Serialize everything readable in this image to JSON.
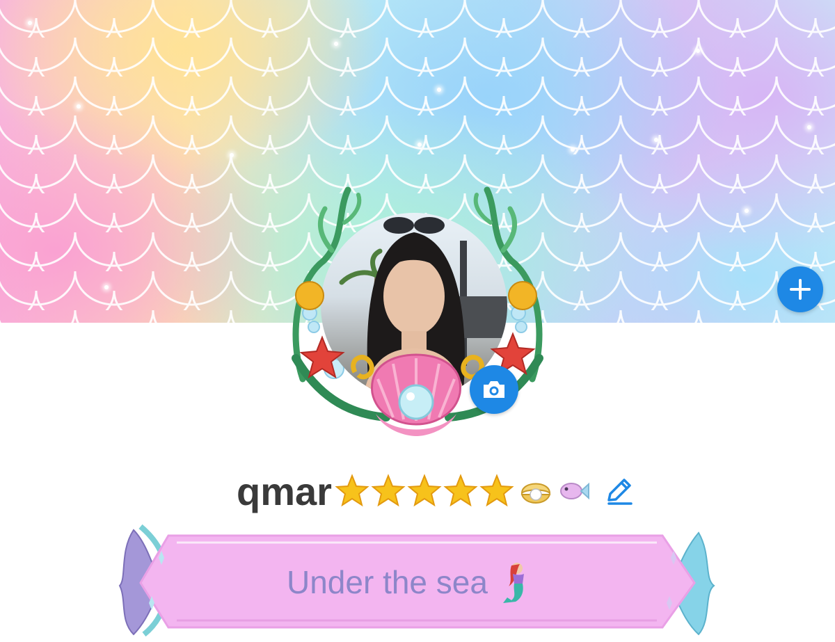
{
  "profile": {
    "username": "qmar",
    "rating_stars": 5,
    "status": "Under the sea"
  },
  "icons": {
    "add_cover": "plus-icon",
    "change_photo": "camera-icon",
    "edit_name": "pencil-icon",
    "name_badges": [
      "star-icon",
      "star-icon",
      "star-icon",
      "star-icon",
      "star-icon",
      "pearl-shell-icon",
      "fish-icon"
    ],
    "status_emoji": "mermaid-icon"
  },
  "colors": {
    "accent": "#1e88e5",
    "username": "#3a3a3a",
    "status_text": "#8d86c9",
    "ribbon": "#f3b5f0"
  }
}
